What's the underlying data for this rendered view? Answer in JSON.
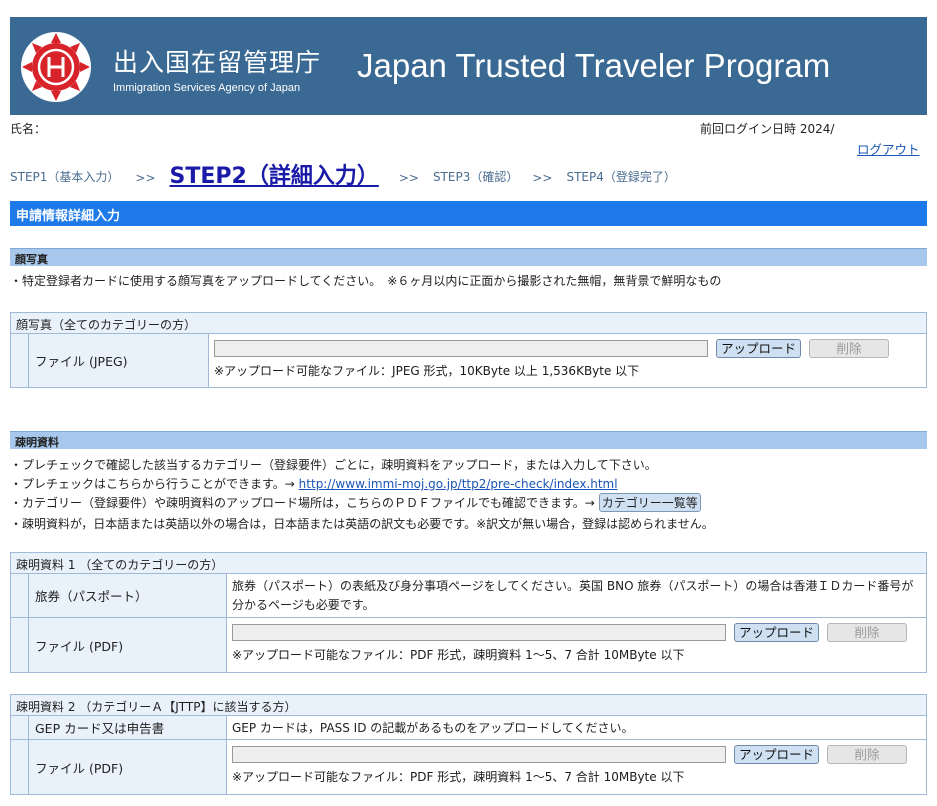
{
  "header": {
    "agency_jp": "出入国在留管理庁",
    "agency_en": "Immigration Services Agency of Japan",
    "program": "Japan Trusted Traveler Program",
    "logo_icon": "immigration-emblem"
  },
  "user": {
    "name_label": "氏名：",
    "last_login": "前回ログイン日時 2024/",
    "logout": "ログアウト"
  },
  "steps": {
    "step1": "STEP1（基本入力）",
    "step2": "STEP2（詳細入力）",
    "step3": "STEP3（確認）",
    "step4": "STEP4（登録完了）",
    "arrow": ">>"
  },
  "main_title": "申請情報詳細入力",
  "photo": {
    "heading": "顔写真",
    "note": "・特定登録者カードに使用する顔写真をアップロードしてください。　※６ヶ月以内に正面から撮影された無帽，無背景で鮮明なもの",
    "box_title": "顔写真（全てのカテゴリーの方）",
    "file_label": "ファイル (JPEG)",
    "upload_button": "アップロード",
    "delete_button": "削除",
    "hint": "※アップロード可能なファイル：JPEG 形式，10KByte 以上 1,536KByte 以下"
  },
  "docs": {
    "heading": "疎明資料",
    "note1": "・プレチェックで確認した該当するカテゴリー（登録要件）ごとに，疎明資料をアップロード，または入力して下さい。",
    "note2_prefix": "・プレチェックはこちらから行うことができます。→ ",
    "note2_link": "http://www.immi-moj.go.jp/ttp2/pre-check/index.html",
    "note3_prefix": "・カテゴリー（登録要件）や疎明資料のアップロード場所は，こちらのＰＤＦファイルでも確認できます。→ ",
    "note3_button": "カテゴリー一覧等",
    "note4": "・疎明資料が，日本語または英語以外の場合は，日本語または英語の訳文も必要です。※訳文が無い場合，登録は認められません。"
  },
  "doc1": {
    "title": "疎明資料 1 （全てのカテゴリーの方）",
    "item_label": "旅券（パスポート）",
    "item_desc": "旅券（パスポート）の表紙及び身分事項ページをしてください。英国 BNO 旅券（パスポート）の場合は香港ＩＤカード番号が分かるページも必要です。",
    "file_label": "ファイル (PDF)",
    "upload_button": "アップロード",
    "delete_button": "削除",
    "hint": "※アップロード可能なファイル：PDF 形式，疎明資料 1～5、7 合計 10MByte 以下"
  },
  "doc2": {
    "title": "疎明資料 2 （カテゴリーＡ【JTTP】に該当する方）",
    "item_label": "GEP カード又は申告書",
    "item_desc": "GEP カードは，PASS ID の記載があるものをアップロードしてください。",
    "file_label": "ファイル (PDF)",
    "upload_button": "アップロード",
    "delete_button": "削除",
    "hint": "※アップロード可能なファイル：PDF 形式，疎明資料 1～5、7 合計 10MByte 以下"
  }
}
